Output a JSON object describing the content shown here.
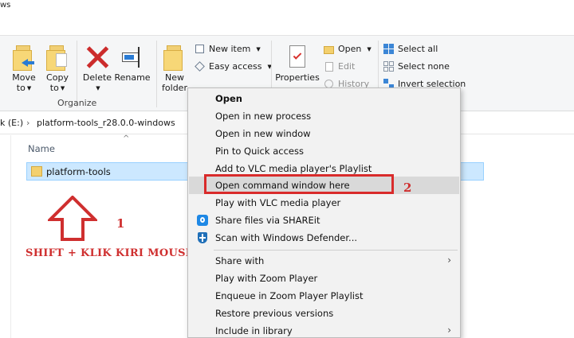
{
  "window": {
    "title_fragment": "ws"
  },
  "ribbon": {
    "group_label": "Organize",
    "move_to": "Move",
    "move_to_2": "to",
    "copy_to": "Copy",
    "copy_to_2": "to",
    "delete": "Delete",
    "rename": "Rename",
    "new_folder": "New",
    "new_folder_2": "folder",
    "new_item": "New item",
    "easy_access": "Easy access",
    "properties": "Properties",
    "open": "Open",
    "edit": "Edit",
    "history": "History",
    "select_all": "Select all",
    "select_none": "Select none",
    "invert_selection": "Invert selection"
  },
  "address": {
    "drive": "k (E:)",
    "separator": "›",
    "folder": "platform-tools_r28.0.0-windows"
  },
  "file_list": {
    "column_name": "Name",
    "sort_glyph": "^",
    "rows": [
      {
        "name": "platform-tools"
      }
    ]
  },
  "annotations": {
    "step1": "1",
    "step2": "2",
    "instruction": "SHIFT + KLIK KIRI MOUSE",
    "highlight_color": "#d92b2b"
  },
  "context_menu": {
    "items": [
      {
        "label": "Open"
      },
      {
        "label": "Open in new process"
      },
      {
        "label": "Open in new window"
      },
      {
        "label": "Pin to Quick access"
      },
      {
        "label": "Add to VLC media player's Playlist"
      },
      {
        "label": "Open command window here"
      },
      {
        "label": "Play with VLC media player"
      },
      {
        "label": "Share files via SHAREit"
      },
      {
        "label": "Scan with Windows Defender..."
      },
      {
        "label": "Share with"
      },
      {
        "label": "Play with Zoom Player"
      },
      {
        "label": "Enqueue in Zoom Player Playlist"
      },
      {
        "label": "Restore previous versions"
      },
      {
        "label": "Include in library"
      }
    ],
    "submenu_glyph": "›"
  },
  "colors": {
    "selection_fill": "#cce8ff",
    "selection_border": "#99d1ff",
    "menu_background": "#f2f2f2",
    "menu_hover": "#d9d9d9"
  }
}
